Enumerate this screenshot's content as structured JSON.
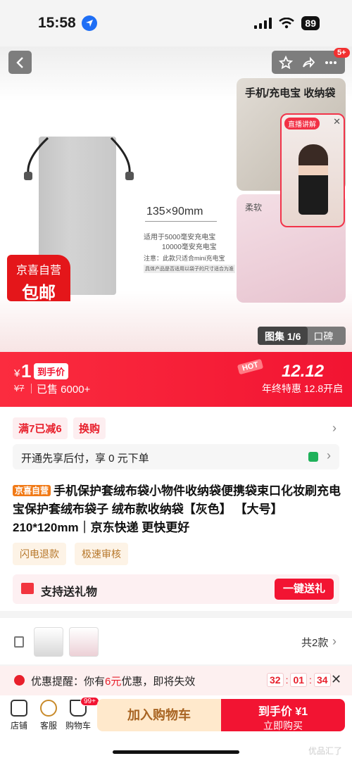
{
  "status_bar": {
    "time": "15:58",
    "battery": "89"
  },
  "header": {
    "more_badge": "5+"
  },
  "hero": {
    "dimension": "135×90mm",
    "note_line1": "适用于5000毫安充电宝",
    "note_line2": "10000毫安充电宝",
    "note_line3": "注意：此款只适合mini充电宝",
    "note_line4": "具体产品是否适用以袋子的尺寸适合为准",
    "promo_line1": "京喜自营",
    "promo_line2": "包邮",
    "thumb1_title": "手机/充电宝 收纳袋",
    "thumb2_title": "柔软",
    "live_tag": "直播讲解",
    "gallery_active": "图集 1/6",
    "gallery_other": "口碑"
  },
  "price_banner": {
    "currency": "¥",
    "price": "1",
    "price_tag": "到手价",
    "original_price": "¥7",
    "sold": "已售 6000+",
    "hot_label": "HOT",
    "event": "12.12",
    "event_sub": "年终特惠 12.8开启"
  },
  "promotions": {
    "discount": "满7已减6",
    "swap": "换购"
  },
  "install": {
    "text": "开通先享后付，享 0 元下单"
  },
  "product": {
    "shop_tag": "京喜自营",
    "title": "手机保护套绒布袋小物件收纳袋便携袋束口化妆刷充电宝保护套绒布袋子 绒布款收纳袋【灰色】 【大号】210*120mm｜京东快递 更快更好"
  },
  "services": [
    "闪电退款",
    "极速审核"
  ],
  "gift": {
    "label": "支持送礼物",
    "button": "一键送礼"
  },
  "variants": {
    "count": "共2款"
  },
  "coupon": {
    "prefix": "优惠提醒：你有",
    "amount": "6元",
    "suffix": "优惠，即将失效",
    "timer": [
      "32",
      "01",
      "34"
    ]
  },
  "bottom_bar": {
    "shop": "店铺",
    "service": "客服",
    "cart": "购物车",
    "cart_badge": "99+",
    "add_to_cart": "加入购物车",
    "buy_line1": "到手价 ¥1",
    "buy_line2": "立即购买",
    "watermark": "优品汇了"
  },
  "colors": {
    "brand_red": "#f21432",
    "accent_orange": "#f17a17"
  }
}
